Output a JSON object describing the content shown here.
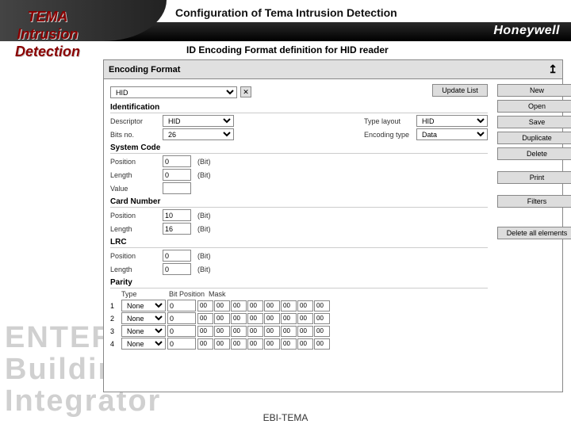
{
  "header": {
    "title": "Configuration of Tema Intrusion Detection",
    "brand": "Honeywell",
    "subtitle": "ID Encoding Format definition for HID reader"
  },
  "sidebar": {
    "line1": "TEMA",
    "line2": "Intrusion",
    "line3": "Detection"
  },
  "panel": {
    "title": "Encoding Format",
    "format_select": "HID",
    "close": "✕",
    "up": "↥",
    "update_btn": "Update List"
  },
  "ident": {
    "section": "Identification",
    "descr_lbl": "Descriptor",
    "descr_val": "HID",
    "typelayout_lbl": "Type layout",
    "typelayout_val": "HID",
    "bitsno_lbl": "Bits no.",
    "bitsno_val": "26",
    "enctype_lbl": "Encoding type",
    "enctype_val": "Data"
  },
  "syscode": {
    "section": "System Code",
    "pos_lbl": "Position",
    "pos_val": "0",
    "pos_unit": "(Bit)",
    "len_lbl": "Length",
    "len_val": "0",
    "len_unit": "(Bit)",
    "val_lbl": "Value",
    "val_val": ""
  },
  "cardnum": {
    "section": "Card Number",
    "pos_lbl": "Position",
    "pos_val": "10",
    "pos_unit": "(Bit)",
    "len_lbl": "Length",
    "len_val": "16",
    "len_unit": "(Bit)"
  },
  "lrc": {
    "section": "LRC",
    "pos_lbl": "Position",
    "pos_val": "0",
    "pos_unit": "(Bit)",
    "len_lbl": "Length",
    "len_val": "0",
    "len_unit": "(Bit)"
  },
  "parity": {
    "section": "Parity",
    "h_type": "Type",
    "h_bitpos": "Bit Position",
    "h_mask": "Mask",
    "rows": [
      {
        "n": "1",
        "type": "None",
        "bitpos": "0",
        "mask": [
          "00",
          "00",
          "00",
          "00",
          "00",
          "00",
          "00",
          "00"
        ]
      },
      {
        "n": "2",
        "type": "None",
        "bitpos": "0",
        "mask": [
          "00",
          "00",
          "00",
          "00",
          "00",
          "00",
          "00",
          "00"
        ]
      },
      {
        "n": "3",
        "type": "None",
        "bitpos": "0",
        "mask": [
          "00",
          "00",
          "00",
          "00",
          "00",
          "00",
          "00",
          "00"
        ]
      },
      {
        "n": "4",
        "type": "None",
        "bitpos": "0",
        "mask": [
          "00",
          "00",
          "00",
          "00",
          "00",
          "00",
          "00",
          "00"
        ]
      }
    ]
  },
  "buttons": {
    "new": "New",
    "open": "Open",
    "save": "Save",
    "duplicate": "Duplicate",
    "delete": "Delete",
    "print": "Print",
    "filters": "Filters",
    "deleteall": "Delete all elements"
  },
  "footer": "EBI-TEMA",
  "bg": {
    "l1": "ENTER",
    "l2": "Buildings",
    "l3": "Integrator"
  }
}
